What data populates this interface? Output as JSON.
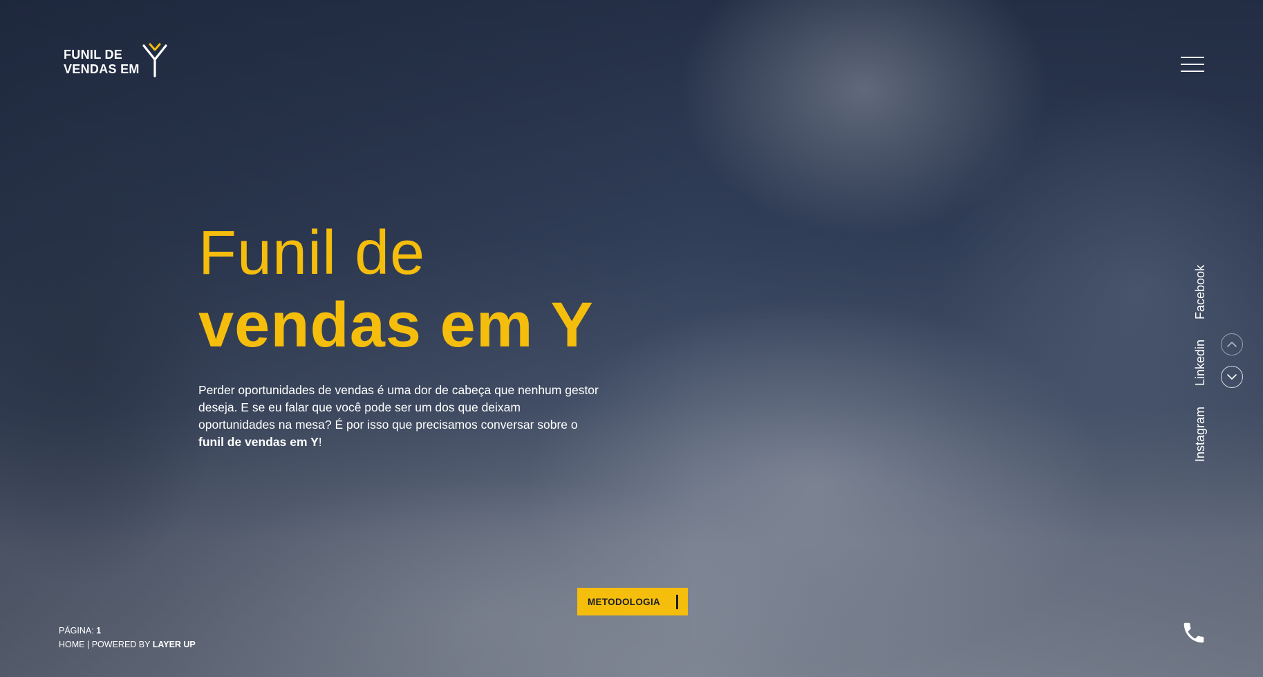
{
  "brand": {
    "logo_line1": "FUNIL DE",
    "logo_line2": "VENDAS EM",
    "logo_mark": "Y",
    "accent_color": "#f5bd0c"
  },
  "header": {
    "menu_icon": "hamburger-menu-icon"
  },
  "hero": {
    "headline_light": "Funil de",
    "headline_bold": "vendas em Y",
    "intro_text": "Perder oportunidades de vendas é uma dor de cabeça que nenhum gestor deseja. E se eu falar que você pode ser um dos que deixam oportunidades na mesa? É por isso que precisamos conversar sobre o",
    "intro_bold": "funil de vendas em Y",
    "intro_end": "!"
  },
  "social": {
    "facebook": "Facebook",
    "linkedin": "Linkedin",
    "instagram": "Instagram"
  },
  "navigation": {
    "up_icon": "chevron-up-icon",
    "down_icon": "chevron-down-icon"
  },
  "cta": {
    "label": "METODOLOGIA"
  },
  "footer": {
    "page_label": "PÁGINA:",
    "page_number": "1",
    "home_label": "HOME",
    "separator": "|",
    "powered_by": "POWERED BY",
    "powered_brand": "LAYER UP"
  },
  "contact": {
    "phone_icon": "phone-icon"
  }
}
